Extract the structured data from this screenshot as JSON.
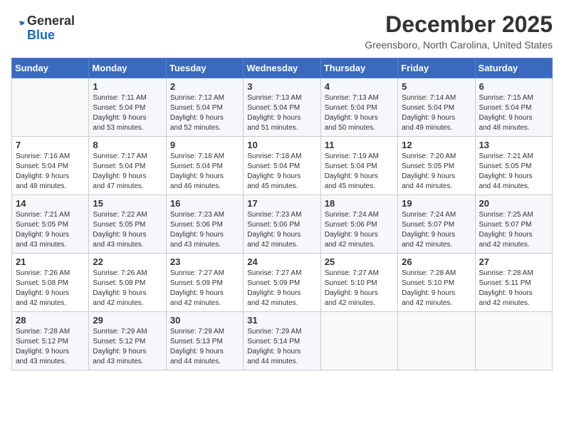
{
  "header": {
    "logo_general": "General",
    "logo_blue": "Blue",
    "month_year": "December 2025",
    "location": "Greensboro, North Carolina, United States"
  },
  "weekdays": [
    "Sunday",
    "Monday",
    "Tuesday",
    "Wednesday",
    "Thursday",
    "Friday",
    "Saturday"
  ],
  "weeks": [
    [
      {
        "day": "",
        "info": ""
      },
      {
        "day": "1",
        "info": "Sunrise: 7:11 AM\nSunset: 5:04 PM\nDaylight: 9 hours\nand 53 minutes."
      },
      {
        "day": "2",
        "info": "Sunrise: 7:12 AM\nSunset: 5:04 PM\nDaylight: 9 hours\nand 52 minutes."
      },
      {
        "day": "3",
        "info": "Sunrise: 7:13 AM\nSunset: 5:04 PM\nDaylight: 9 hours\nand 51 minutes."
      },
      {
        "day": "4",
        "info": "Sunrise: 7:13 AM\nSunset: 5:04 PM\nDaylight: 9 hours\nand 50 minutes."
      },
      {
        "day": "5",
        "info": "Sunrise: 7:14 AM\nSunset: 5:04 PM\nDaylight: 9 hours\nand 49 minutes."
      },
      {
        "day": "6",
        "info": "Sunrise: 7:15 AM\nSunset: 5:04 PM\nDaylight: 9 hours\nand 48 minutes."
      }
    ],
    [
      {
        "day": "7",
        "info": "Sunrise: 7:16 AM\nSunset: 5:04 PM\nDaylight: 9 hours\nand 48 minutes."
      },
      {
        "day": "8",
        "info": "Sunrise: 7:17 AM\nSunset: 5:04 PM\nDaylight: 9 hours\nand 47 minutes."
      },
      {
        "day": "9",
        "info": "Sunrise: 7:18 AM\nSunset: 5:04 PM\nDaylight: 9 hours\nand 46 minutes."
      },
      {
        "day": "10",
        "info": "Sunrise: 7:18 AM\nSunset: 5:04 PM\nDaylight: 9 hours\nand 45 minutes."
      },
      {
        "day": "11",
        "info": "Sunrise: 7:19 AM\nSunset: 5:04 PM\nDaylight: 9 hours\nand 45 minutes."
      },
      {
        "day": "12",
        "info": "Sunrise: 7:20 AM\nSunset: 5:05 PM\nDaylight: 9 hours\nand 44 minutes."
      },
      {
        "day": "13",
        "info": "Sunrise: 7:21 AM\nSunset: 5:05 PM\nDaylight: 9 hours\nand 44 minutes."
      }
    ],
    [
      {
        "day": "14",
        "info": "Sunrise: 7:21 AM\nSunset: 5:05 PM\nDaylight: 9 hours\nand 43 minutes."
      },
      {
        "day": "15",
        "info": "Sunrise: 7:22 AM\nSunset: 5:05 PM\nDaylight: 9 hours\nand 43 minutes."
      },
      {
        "day": "16",
        "info": "Sunrise: 7:23 AM\nSunset: 5:06 PM\nDaylight: 9 hours\nand 43 minutes."
      },
      {
        "day": "17",
        "info": "Sunrise: 7:23 AM\nSunset: 5:06 PM\nDaylight: 9 hours\nand 42 minutes."
      },
      {
        "day": "18",
        "info": "Sunrise: 7:24 AM\nSunset: 5:06 PM\nDaylight: 9 hours\nand 42 minutes."
      },
      {
        "day": "19",
        "info": "Sunrise: 7:24 AM\nSunset: 5:07 PM\nDaylight: 9 hours\nand 42 minutes."
      },
      {
        "day": "20",
        "info": "Sunrise: 7:25 AM\nSunset: 5:07 PM\nDaylight: 9 hours\nand 42 minutes."
      }
    ],
    [
      {
        "day": "21",
        "info": "Sunrise: 7:26 AM\nSunset: 5:08 PM\nDaylight: 9 hours\nand 42 minutes."
      },
      {
        "day": "22",
        "info": "Sunrise: 7:26 AM\nSunset: 5:08 PM\nDaylight: 9 hours\nand 42 minutes."
      },
      {
        "day": "23",
        "info": "Sunrise: 7:27 AM\nSunset: 5:09 PM\nDaylight: 9 hours\nand 42 minutes."
      },
      {
        "day": "24",
        "info": "Sunrise: 7:27 AM\nSunset: 5:09 PM\nDaylight: 9 hours\nand 42 minutes."
      },
      {
        "day": "25",
        "info": "Sunrise: 7:27 AM\nSunset: 5:10 PM\nDaylight: 9 hours\nand 42 minutes."
      },
      {
        "day": "26",
        "info": "Sunrise: 7:28 AM\nSunset: 5:10 PM\nDaylight: 9 hours\nand 42 minutes."
      },
      {
        "day": "27",
        "info": "Sunrise: 7:28 AM\nSunset: 5:11 PM\nDaylight: 9 hours\nand 42 minutes."
      }
    ],
    [
      {
        "day": "28",
        "info": "Sunrise: 7:28 AM\nSunset: 5:12 PM\nDaylight: 9 hours\nand 43 minutes."
      },
      {
        "day": "29",
        "info": "Sunrise: 7:29 AM\nSunset: 5:12 PM\nDaylight: 9 hours\nand 43 minutes."
      },
      {
        "day": "30",
        "info": "Sunrise: 7:29 AM\nSunset: 5:13 PM\nDaylight: 9 hours\nand 44 minutes."
      },
      {
        "day": "31",
        "info": "Sunrise: 7:29 AM\nSunset: 5:14 PM\nDaylight: 9 hours\nand 44 minutes."
      },
      {
        "day": "",
        "info": ""
      },
      {
        "day": "",
        "info": ""
      },
      {
        "day": "",
        "info": ""
      }
    ]
  ]
}
